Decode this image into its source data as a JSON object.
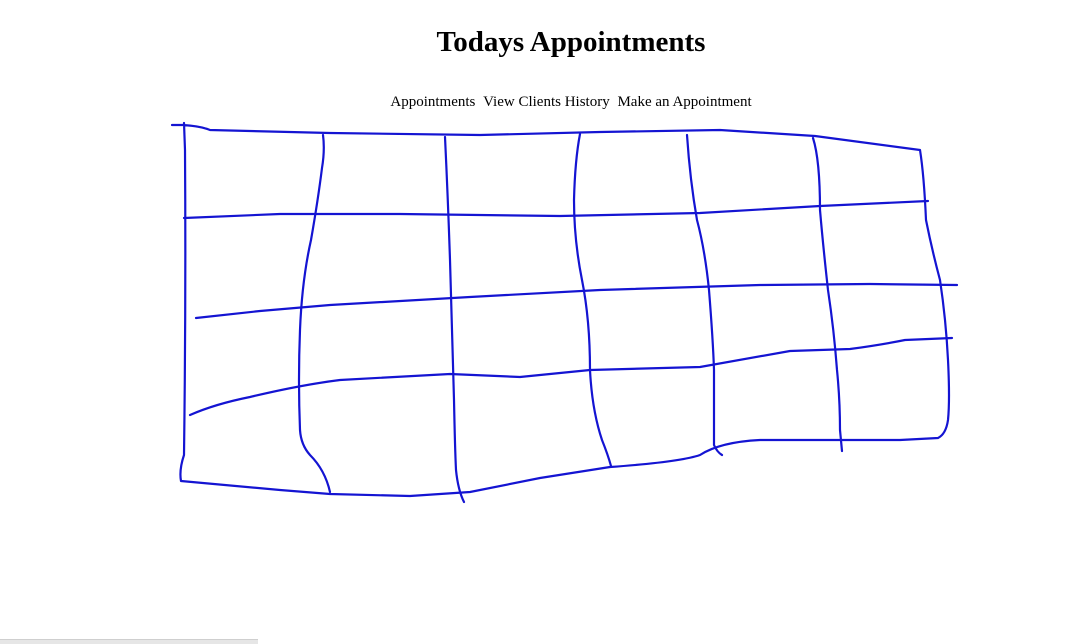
{
  "page": {
    "title": "Todays Appointments"
  },
  "nav": {
    "items": [
      {
        "label": "Appointments"
      },
      {
        "label": "View Clients History"
      },
      {
        "label": "Make an Appointment"
      }
    ]
  },
  "colors": {
    "ink": "#1414d2",
    "background": "#ffffff"
  }
}
